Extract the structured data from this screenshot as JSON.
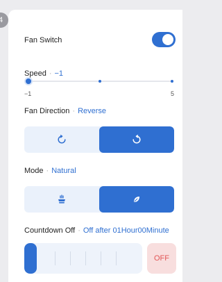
{
  "corner_badge": "4",
  "fan_switch": {
    "label": "Fan Switch",
    "on": true
  },
  "speed": {
    "label": "Speed",
    "value": "−1",
    "min_label": "−1",
    "max_label": "5",
    "level": 0
  },
  "direction": {
    "label": "Fan Direction",
    "value": "Reverse",
    "options": [
      "forward",
      "reverse"
    ],
    "selected": "reverse"
  },
  "mode": {
    "label": "Mode",
    "value": "Natural",
    "options": [
      "normal",
      "natural"
    ],
    "selected": "natural"
  },
  "countdown": {
    "label": "Countdown Off",
    "value": "Off after 01Hour00Minute",
    "off_label": "OFF"
  },
  "colors": {
    "accent": "#2f6fd1",
    "off": "#e25656"
  },
  "icons": [
    "rotate-ccw-icon",
    "rotate-cw-icon",
    "fan-normal-icon",
    "leaf-icon"
  ]
}
